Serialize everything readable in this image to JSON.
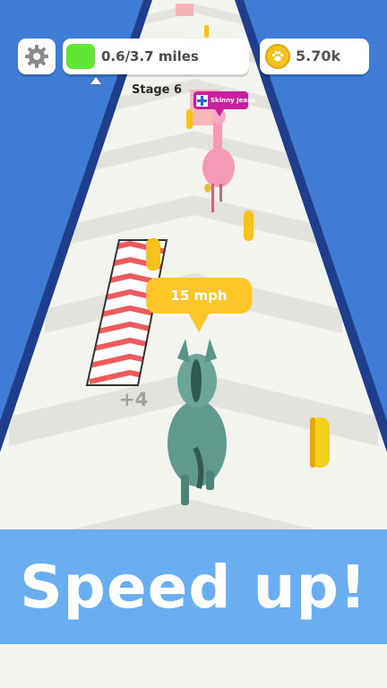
{
  "hud": {
    "settings_icon": "gear-icon",
    "progress_text": "0.6/3.7 miles",
    "progress_value": 0.6,
    "progress_total": 3.7,
    "stage_label": "Stage 6",
    "coins_icon": "coin-paw-icon",
    "coins_text": "5.70k"
  },
  "player": {
    "speed_text": "15 mph",
    "bonus_text": "+4"
  },
  "rival": {
    "name": "Skinny Jeans",
    "flag_icon": "cross-flag-icon"
  },
  "banner": {
    "text": "Speed up!"
  },
  "colors": {
    "sky_blue": "#3f7cd6",
    "track_white": "#f3f3f0",
    "chevron_grey": "#e3e3e0",
    "progress_green": "#5ee632",
    "coin_gold": "#f7c21c",
    "bubble_yellow": "#ffc629",
    "rival_pink": "#c81f9e",
    "banner_blue": "#6aaef2",
    "boost_red": "#ef5b5b"
  }
}
